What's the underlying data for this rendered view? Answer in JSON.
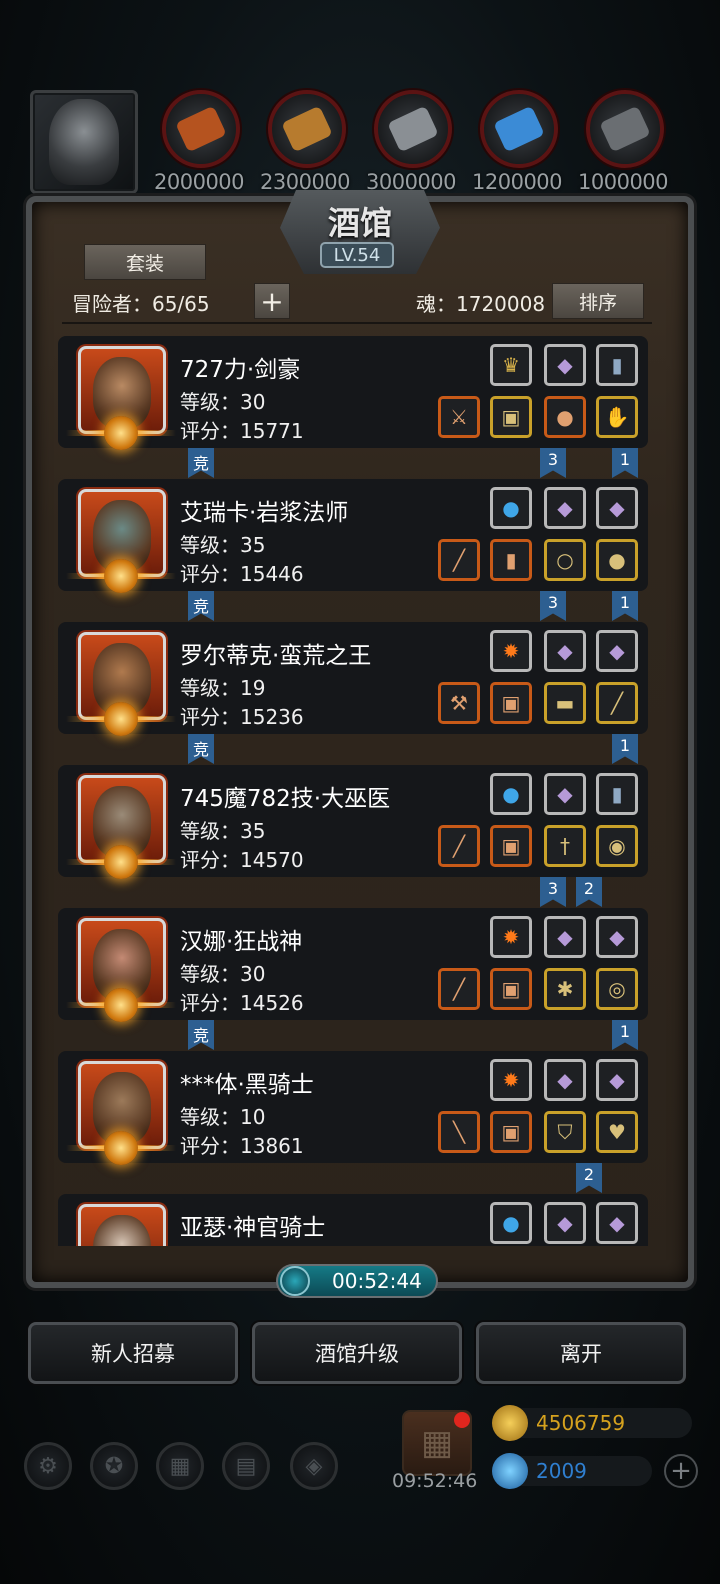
{
  "resources": {
    "slots": [
      {
        "name": "ore",
        "icon": "ore-icon",
        "color": "#b5531f"
      },
      {
        "name": "wood",
        "icon": "wood-plank-icon",
        "color": "#b77b2e"
      },
      {
        "name": "iron",
        "icon": "iron-ingot-icon",
        "color": "#8a8f94"
      },
      {
        "name": "crystal",
        "icon": "crystal-icon",
        "color": "#3b8bd6"
      },
      {
        "name": "stone",
        "icon": "stone-icon",
        "color": "#6a6e72"
      }
    ],
    "amounts": [
      "2000000",
      "2300000",
      "3000000",
      "1200000",
      "1000000"
    ]
  },
  "panel": {
    "title": "酒馆",
    "level": "LV.54",
    "set_button": "套装",
    "adventurers_label": "冒险者：65/65",
    "add_symbol": "+",
    "soul_label": "魂：1720008",
    "sort_button": "排序"
  },
  "heroes": [
    {
      "name": "727力·剑豪",
      "level": "等级：30",
      "score": "评分：15771",
      "skin": "#b98a63",
      "runes": [
        {
          "icon": "emblem-icon",
          "glyph": "♛",
          "color": "#d8b24a"
        },
        {
          "icon": "purple-gem-icon",
          "glyph": "◆",
          "color": "#b69ad8"
        },
        {
          "icon": "book-icon",
          "glyph": "▮",
          "color": "#8fa9c4"
        }
      ],
      "gear": [
        {
          "icon": "sword-icon",
          "glyph": "⚔",
          "tier": "red"
        },
        {
          "icon": "armor-icon",
          "glyph": "▣",
          "tier": "gold"
        },
        {
          "icon": "ring-icon",
          "glyph": "●",
          "tier": "red"
        },
        {
          "icon": "gauntlet-icon",
          "glyph": "✋",
          "tier": "gold"
        }
      ],
      "tags": [
        {
          "label": "竞",
          "slot": 0
        },
        {
          "label": "3",
          "slot": 3
        },
        {
          "label": "1",
          "slot": 5
        }
      ]
    },
    {
      "name": "艾瑞卡·岩浆法师",
      "level": "等级：35",
      "score": "评分：15446",
      "skin": "#6b8a86",
      "runes": [
        {
          "icon": "blue-orb-icon",
          "glyph": "●",
          "color": "#3fa6e8"
        },
        {
          "icon": "purple-gem-icon",
          "glyph": "◆",
          "color": "#b69ad8"
        },
        {
          "icon": "purple-gem-icon",
          "glyph": "◆",
          "color": "#b69ad8"
        }
      ],
      "gear": [
        {
          "icon": "staff-icon",
          "glyph": "╱",
          "tier": "red"
        },
        {
          "icon": "robe-icon",
          "glyph": "▮",
          "tier": "red"
        },
        {
          "icon": "amulet-icon",
          "glyph": "○",
          "tier": "gold"
        },
        {
          "icon": "ring-icon",
          "glyph": "●",
          "tier": "gold"
        }
      ],
      "tags": [
        {
          "label": "竞",
          "slot": 0
        },
        {
          "label": "3",
          "slot": 3
        },
        {
          "label": "1",
          "slot": 5
        }
      ]
    },
    {
      "name": "罗尔蒂克·蛮荒之王",
      "level": "等级：19",
      "score": "评分：15236",
      "skin": "#b07a4e",
      "runes": [
        {
          "icon": "fire-icon",
          "glyph": "✹",
          "color": "#ff7a1a"
        },
        {
          "icon": "purple-gem-icon",
          "glyph": "◆",
          "color": "#b69ad8"
        },
        {
          "icon": "purple-gem-icon",
          "glyph": "◆",
          "color": "#b69ad8"
        }
      ],
      "gear": [
        {
          "icon": "axe-icon",
          "glyph": "⚒",
          "tier": "red"
        },
        {
          "icon": "chest-armor-icon",
          "glyph": "▣",
          "tier": "red"
        },
        {
          "icon": "bracer-icon",
          "glyph": "▬",
          "tier": "gold"
        },
        {
          "icon": "bone-icon",
          "glyph": "╱",
          "tier": "gold"
        }
      ],
      "tags": [
        {
          "label": "竞",
          "slot": 0
        },
        {
          "label": "1",
          "slot": 5
        }
      ]
    },
    {
      "name": "745魔782技·大巫医",
      "level": "等级：35",
      "score": "评分：14570",
      "skin": "#9a8b78",
      "runes": [
        {
          "icon": "blue-orb-icon",
          "glyph": "●",
          "color": "#3fa6e8"
        },
        {
          "icon": "purple-gem-icon",
          "glyph": "◆",
          "color": "#b69ad8"
        },
        {
          "icon": "book-icon",
          "glyph": "▮",
          "color": "#8fa9c4"
        }
      ],
      "gear": [
        {
          "icon": "staff-icon",
          "glyph": "╱",
          "tier": "red"
        },
        {
          "icon": "armor-icon",
          "glyph": "▣",
          "tier": "red"
        },
        {
          "icon": "dagger-icon",
          "glyph": "†",
          "tier": "gold"
        },
        {
          "icon": "eye-icon",
          "glyph": "◉",
          "tier": "gold"
        }
      ],
      "tags": [
        {
          "label": "3",
          "slot": 3
        },
        {
          "label": "2",
          "slot": 4
        }
      ]
    },
    {
      "name": "汉娜·狂战神",
      "level": "等级：30",
      "score": "评分：14526",
      "skin": "#c48a74",
      "runes": [
        {
          "icon": "fire-icon",
          "glyph": "✹",
          "color": "#ff7a1a"
        },
        {
          "icon": "purple-gem-icon",
          "glyph": "◆",
          "color": "#b69ad8"
        },
        {
          "icon": "purple-gem-icon",
          "glyph": "◆",
          "color": "#b69ad8"
        }
      ],
      "gear": [
        {
          "icon": "mace-icon",
          "glyph": "╱",
          "tier": "red"
        },
        {
          "icon": "green-armor-icon",
          "glyph": "▣",
          "tier": "red"
        },
        {
          "icon": "spider-icon",
          "glyph": "✱",
          "tier": "gold"
        },
        {
          "icon": "shield-round-icon",
          "glyph": "◎",
          "tier": "gold"
        }
      ],
      "tags": [
        {
          "label": "竞",
          "slot": 0
        },
        {
          "label": "1",
          "slot": 5
        }
      ]
    },
    {
      "name": "***体·黑骑士",
      "level": "等级：10",
      "score": "评分：13861",
      "skin": "#9c7a5a",
      "runes": [
        {
          "icon": "fire-icon",
          "glyph": "✹",
          "color": "#ff7a1a"
        },
        {
          "icon": "purple-gem-icon",
          "glyph": "◆",
          "color": "#b69ad8"
        },
        {
          "icon": "purple-gem-icon",
          "glyph": "◆",
          "color": "#b69ad8"
        }
      ],
      "gear": [
        {
          "icon": "greatsword-icon",
          "glyph": "╲",
          "tier": "red"
        },
        {
          "icon": "armor-icon",
          "glyph": "▣",
          "tier": "red"
        },
        {
          "icon": "shield-icon",
          "glyph": "⛉",
          "tier": "gold"
        },
        {
          "icon": "pendant-icon",
          "glyph": "♥",
          "tier": "gold"
        }
      ],
      "tags": [
        {
          "label": "2",
          "slot": 4
        }
      ]
    },
    {
      "name": "亚瑟·神官骑士",
      "level": "",
      "score": "",
      "skin": "#d6c4b4",
      "runes": [
        {
          "icon": "blue-orb-icon",
          "glyph": "●",
          "color": "#3fa6e8"
        },
        {
          "icon": "purple-gem-icon",
          "glyph": "◆",
          "color": "#b69ad8"
        },
        {
          "icon": "purple-gem-icon",
          "glyph": "◆",
          "color": "#b69ad8"
        }
      ],
      "gear": [],
      "tags": []
    }
  ],
  "timer": "00:52:44",
  "actions": [
    "新人招募",
    "酒馆升级",
    "离开"
  ],
  "bottom": {
    "gift_time": "09:52:46",
    "gold": "4506759",
    "gems": "2009",
    "gold_color": "#d6a21e",
    "gem_color": "#2f7fd0",
    "nav_icons": [
      "settings-icon",
      "star-icon",
      "castle-icon",
      "book-icon",
      "cube-icon"
    ]
  }
}
